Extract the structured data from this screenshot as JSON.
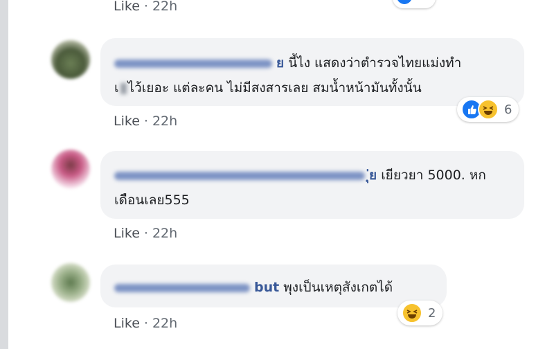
{
  "comments": [
    {
      "name_tail": "ย",
      "text_line1": "นี้ไง แสดงว่าตำรวจไทยแม่งทำ",
      "text_line2_prefix": "เ",
      "text_line2_suffix": "ไว้เยอะ แต่ละคน ไม่มีสงสารเลย สมน้ำหน้ามันทั้งนั้น",
      "like_label": "Like",
      "time": "22h",
      "reaction_count": "6"
    },
    {
      "name_tail": "ุ่ย",
      "text_line1": "เยียวยา 5000. หก",
      "text_line2": "เดือนเลย555",
      "like_label": "Like",
      "time": "22h"
    },
    {
      "name_tail": "but",
      "text_line1": "พุงเป็นเหตุสังเกตได้",
      "like_label": "Like",
      "time": "22h",
      "reaction_count": "2"
    }
  ],
  "top_meta": {
    "like_label": "Like",
    "time": "22h"
  },
  "colors": {
    "like_blue": "#1877f2",
    "haha_yellow": "#f7c22e",
    "bubble": "#f2f3f5",
    "name": "#385898"
  }
}
